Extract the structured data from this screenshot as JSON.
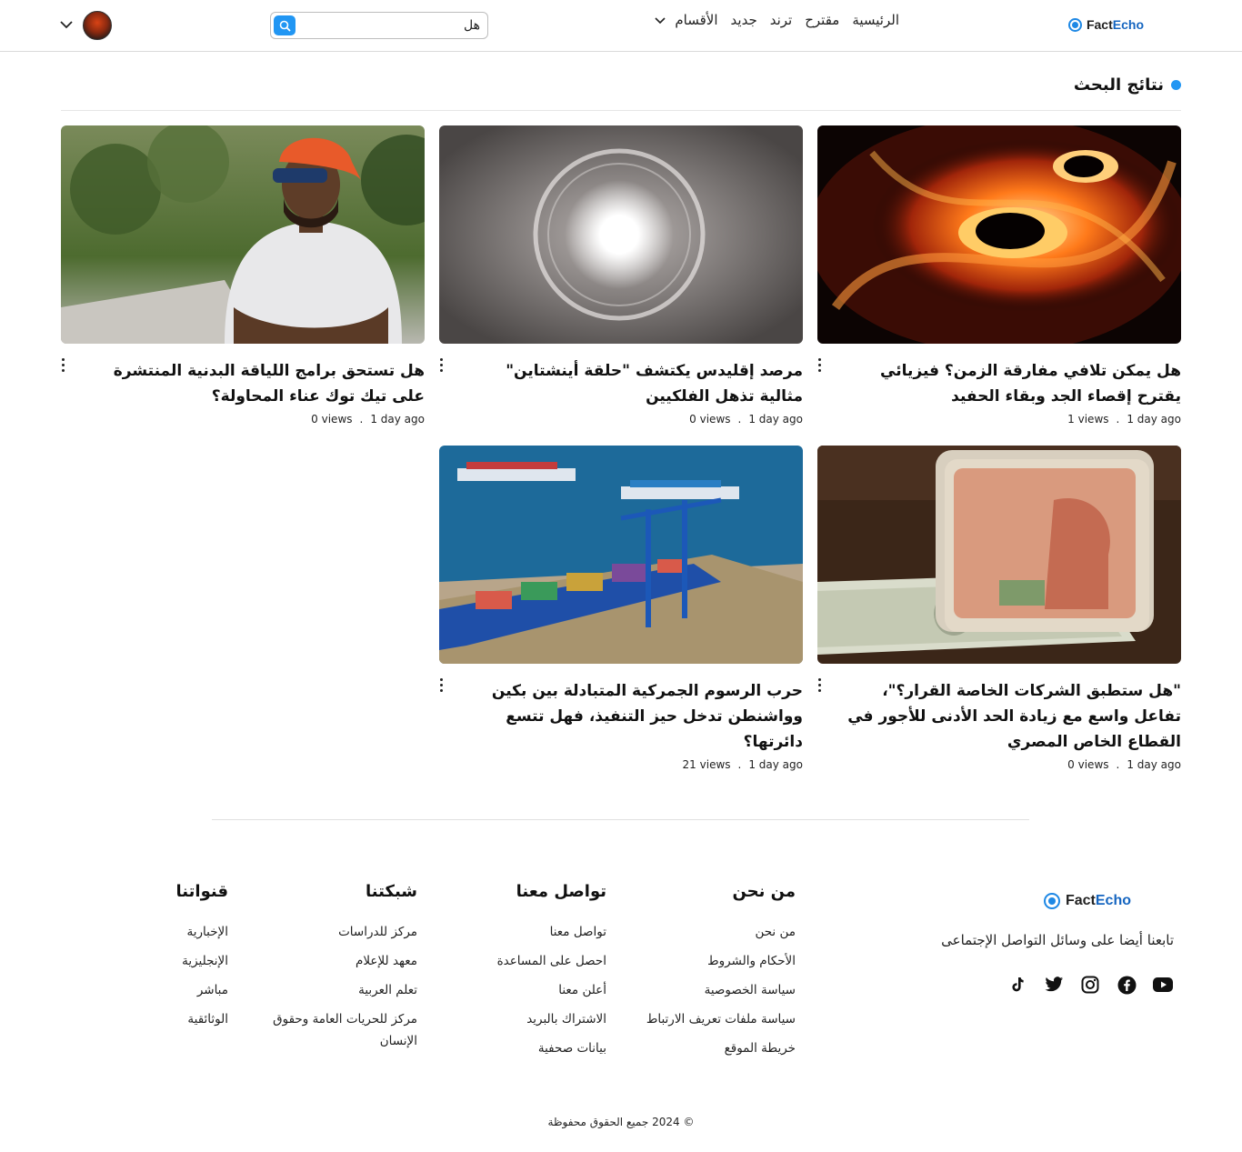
{
  "brand": {
    "fact": "Fact",
    "echo": "Echo"
  },
  "header": {
    "nav": [
      {
        "label": "الرئيسية"
      },
      {
        "label": "مقترح"
      },
      {
        "label": "ترند"
      },
      {
        "label": "جديد"
      },
      {
        "label": "الأقسام",
        "has_dropdown": true
      }
    ],
    "search": {
      "value": "هل",
      "button_icon": "search-icon"
    },
    "user_icon": "avatar",
    "user_menu_icon": "chevron-down-icon"
  },
  "results": {
    "title": "نتائج البحث",
    "accent": "#2196f3",
    "cards": [
      {
        "headline": "هل يمكن تلافي مفارقة الزمن؟ فيزيائي يقترح إقصاء الجد وبقاء الحفيد",
        "time": "1 day ago",
        "views": "1 views",
        "image": "black-holes"
      },
      {
        "headline": "مرصد إقليدس يكتشف \"حلقة أينشتاين\" مثالية تذهل الفلكيين",
        "time": "1 day ago",
        "views": "0 views",
        "image": "einstein-ring"
      },
      {
        "headline": "هل تستحق برامج اللياقة البدنية المنتشرة على تيك توك عناء المحاولة؟",
        "time": "1 day ago",
        "views": "0 views",
        "image": "fitness-man"
      },
      {
        "headline": "\"هل ستطبق الشركات الخاصة القرار؟\"، تفاعل واسع مع زيادة الحد الأدنى للأجور في القطاع الخاص المصري",
        "time": "1 day ago",
        "views": "0 views",
        "image": "egyptian-pounds-dollars"
      },
      {
        "headline": "حرب الرسوم الجمركية المتبادلة بين بكين وواشنطن تدخل حيز التنفيذ، فهل تتسع دائرتها؟",
        "time": "1 day ago",
        "views": "21 views",
        "image": "container-port"
      }
    ]
  },
  "footer": {
    "follow_text": "تابعنا أيضا على وسائل التواصل الإجتماعى",
    "socials": [
      "youtube-icon",
      "facebook-icon",
      "instagram-icon",
      "twitter-icon",
      "tiktok-icon"
    ],
    "columns": [
      {
        "title": "من نحن",
        "links": [
          "من نحن",
          "الأحكام والشروط",
          "سياسة الخصوصية",
          "سياسة ملفات تعريف الارتباط",
          "خريطة الموقع"
        ]
      },
      {
        "title": "تواصل معنا",
        "links": [
          "تواصل معنا",
          "احصل على المساعدة",
          "أعلن معنا",
          "الاشتراك بالبريد",
          "بيانات صحفية"
        ]
      },
      {
        "title": "شبكتنا",
        "links": [
          "مركز للدراسات",
          "معهد للإعلام",
          "تعلم العربية",
          "مركز للحريات العامة وحقوق الإنسان"
        ]
      },
      {
        "title": "قنواتنا",
        "links": [
          "الإخبارية",
          "الإنجليزية",
          "مباشر",
          "الوثائقية"
        ]
      }
    ],
    "copyright": "© 2024 جميع الحقوق محفوظة"
  }
}
